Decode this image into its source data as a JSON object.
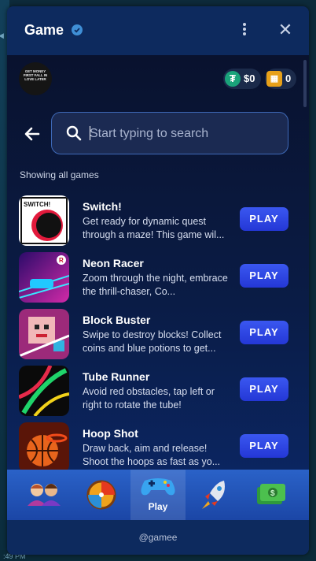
{
  "window": {
    "title": "Game"
  },
  "header": {
    "cash": "$0",
    "tickets": "0"
  },
  "search": {
    "placeholder": "Start typing to search"
  },
  "list": {
    "heading": "Showing all games",
    "games": [
      {
        "name": "Switch!",
        "desc": "Get ready for dynamic quest through a maze! This game wil...",
        "button": "PLAY"
      },
      {
        "name": "Neon Racer",
        "desc": "Zoom through the night, embrace the thrill-chaser, Co...",
        "button": "PLAY"
      },
      {
        "name": "Block Buster",
        "desc": "Swipe to destroy blocks! Collect coins and blue potions to get...",
        "button": "PLAY"
      },
      {
        "name": "Tube Runner",
        "desc": "Avoid red obstacles, tap left or right to rotate the tube!",
        "button": "PLAY"
      },
      {
        "name": "Hoop Shot",
        "desc": "Draw back, aim and release! Shoot the hoops as fast as yo...",
        "button": "PLAY"
      }
    ]
  },
  "avatar_text": "GET MONEY FIRST FALL IN LOVE LATER",
  "nav": {
    "play_label": "Play"
  },
  "footer": {
    "handle": "@gamee"
  },
  "background": {
    "timestamp": ":49 PM"
  },
  "colors": {
    "accent": "#2f48e6",
    "panel": "#0a2350",
    "nav": "#2a62c8"
  },
  "icons": [
    "verified-icon",
    "more-vertical-icon",
    "close-icon",
    "back-arrow-icon",
    "search-icon",
    "cash-coin-icon",
    "ticket-icon",
    "friends-icon",
    "wheel-icon",
    "gamepad-icon",
    "rocket-icon",
    "money-icon"
  ]
}
